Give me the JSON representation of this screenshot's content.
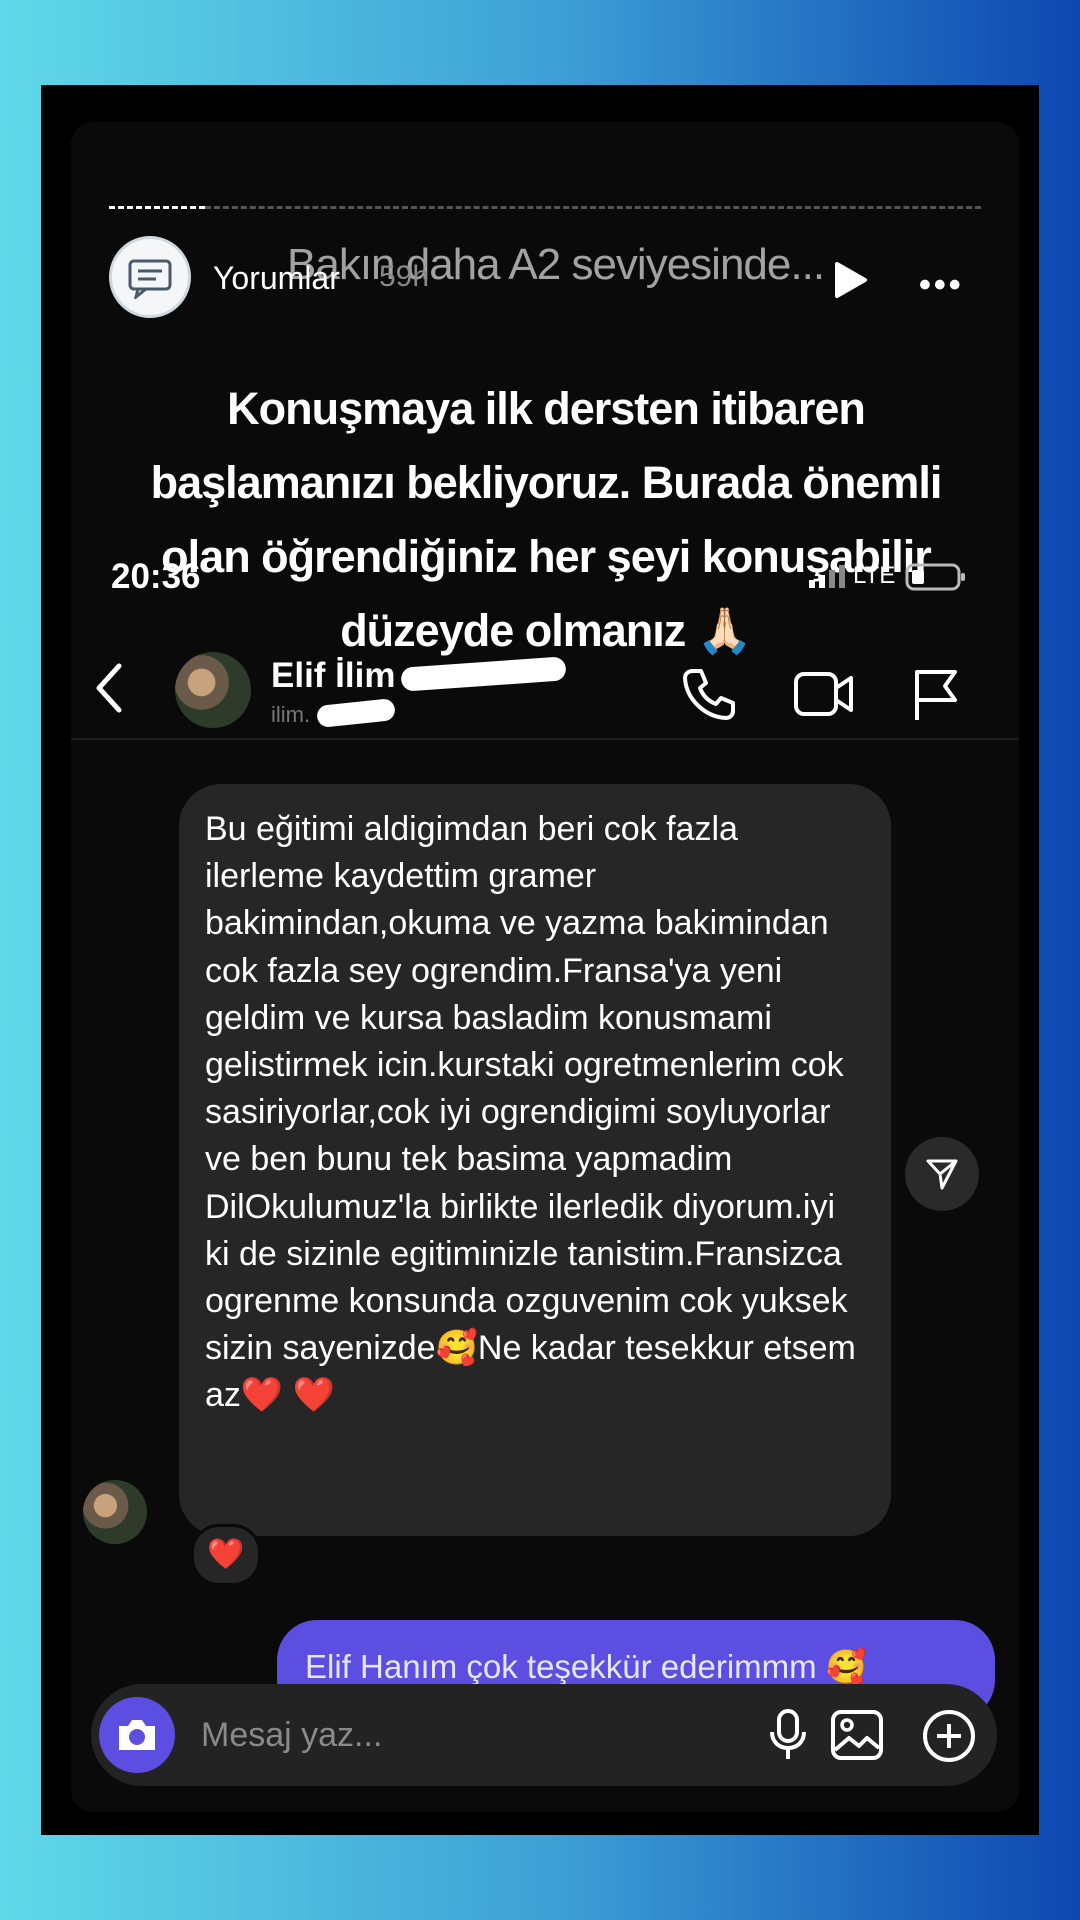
{
  "story": {
    "user": "Yorumlar",
    "time": "59h",
    "title": "Bakın daha A2 seviyesinde...",
    "more_label": "•••",
    "caption": "Konuşmaya ilk dersten itibaren başlamanızı bekliyoruz. Burada önemli olan öğrendiğiniz her şeyi konuşabilir düzeyde olmanız 🙏🏻"
  },
  "status_bar": {
    "time": "20:36",
    "network": "LTE"
  },
  "chat": {
    "contact_name": "Elif İlim",
    "contact_handle": "ilim."
  },
  "messages": {
    "incoming_text": "Bu eğitimi aldigimdan beri cok fazla ilerleme kaydettim gramer bakimindan,okuma ve yazma bakimindan cok fazla sey ogrendim.Fransa'ya yeni geldim ve kursa basladim konusmami gelistirmek icin.kurstaki ogretmenlerim cok sasiriyorlar,cok iyi ogrendigimi soyluyorlar  ve ben bunu tek basima yapmadim DilOkulumuz'la birlikte ilerledik diyorum.iyi ki de sizinle egitiminizle tanistim.Fransizca ogrenme konsunda ozguvenim cok yuksek sizin sayenizde🥰Ne kadar tesekkur etsem az❤️ ❤️",
    "reaction": "❤️",
    "outgoing_text": "Elif Hanım çok teşekkür ederimmm 🥰"
  },
  "composer": {
    "placeholder": "Mesaj yaz..."
  },
  "icons": {
    "story_avatar": "chat-bubble-icon",
    "play": "play-icon",
    "back": "chevron-left-icon",
    "call": "phone-icon",
    "video": "video-camera-icon",
    "report": "flag-icon",
    "share": "send-icon",
    "camera": "camera-icon",
    "mic": "microphone-icon",
    "gallery": "image-icon",
    "add": "plus-circle-icon"
  },
  "colors": {
    "outgoing_bubble": "#5b4ee0",
    "incoming_bubble": "#262626",
    "background_left": "#5fd9e8",
    "background_right": "#0d47b0"
  }
}
